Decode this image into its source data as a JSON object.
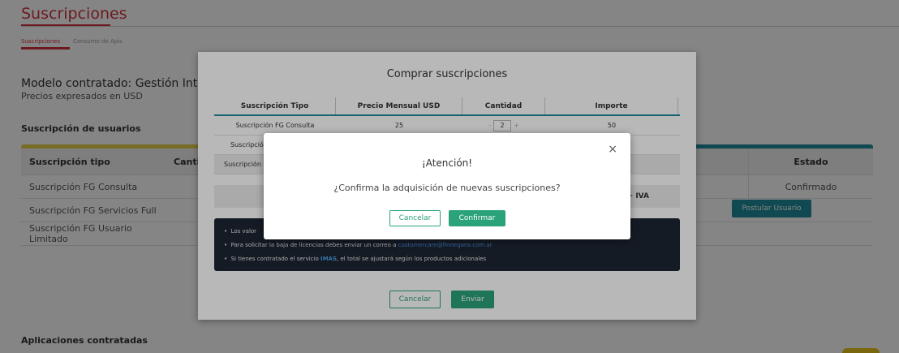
{
  "page": {
    "title": "Suscripciones",
    "tabs": [
      {
        "label": "Suscripciones",
        "active": true
      },
      {
        "label": "Consumo de Apis",
        "active": false
      }
    ],
    "model_title": "Modelo contratado: Gestión Integ",
    "model_subtitle": "Precios expresados en USD",
    "users_section_title": "Suscripción de usuarios",
    "users_table": {
      "headers": {
        "tipo": "Suscripción tipo",
        "cantidad": "Canti",
        "estado": "Estado"
      },
      "rows": [
        {
          "tipo": "Suscripción FG Consulta",
          "estado": "Confirmado"
        },
        {
          "tipo": "Suscripción FG Servicios Full",
          "estado": ""
        },
        {
          "tipo": "Suscripción FG Usuario Limitado",
          "estado": ""
        }
      ]
    },
    "postular_label": "Postular Usuario",
    "apps_section_title": "Aplicaciones contratadas",
    "accent_red": "#d0323f",
    "accent_teal": "#1f8c9c",
    "accent_yellow": "#e8d24a"
  },
  "purchase_modal": {
    "title": "Comprar suscripciones",
    "headers": [
      "Suscripción Tipo",
      "Precio Mensual USD",
      "Cantidad",
      "Importe"
    ],
    "rows": [
      {
        "tipo": "Suscripción FG Consulta",
        "precio": "25",
        "cantidad": "2",
        "importe": "50"
      },
      {
        "tipo": "Suscripción",
        "precio": "",
        "cantidad": "",
        "importe": ""
      },
      {
        "tipo": "Suscripción",
        "precio": "",
        "cantidad": "",
        "importe": ""
      }
    ],
    "stepper_minus": "-",
    "stepper_plus": "+",
    "total_suffix": "+ IVA",
    "info_lines": [
      {
        "prefix": "Los valor",
        "link": "",
        "bold": "",
        "suffix": ""
      },
      {
        "prefix": "Para solicitar la baja de licencias debes enviar un correo a ",
        "link": "customercare@finnegans.com.ar",
        "bold": "",
        "suffix": ""
      },
      {
        "prefix": "Si tienes contratado el servicio ",
        "link": "",
        "bold": "IMAS",
        "suffix": ", el total se ajustará según los productos adicionales"
      }
    ],
    "cancel_label": "Cancelar",
    "send_label": "Enviar",
    "accent_green": "#2aa27a",
    "info_bg": "#1e2633"
  },
  "confirm_modal": {
    "title": "¡Atención!",
    "message": "¿Confirma la adquisición de nuevas suscripciones?",
    "cancel_label": "Cancelar",
    "confirm_label": "Confirmar",
    "close_glyph": "×"
  }
}
